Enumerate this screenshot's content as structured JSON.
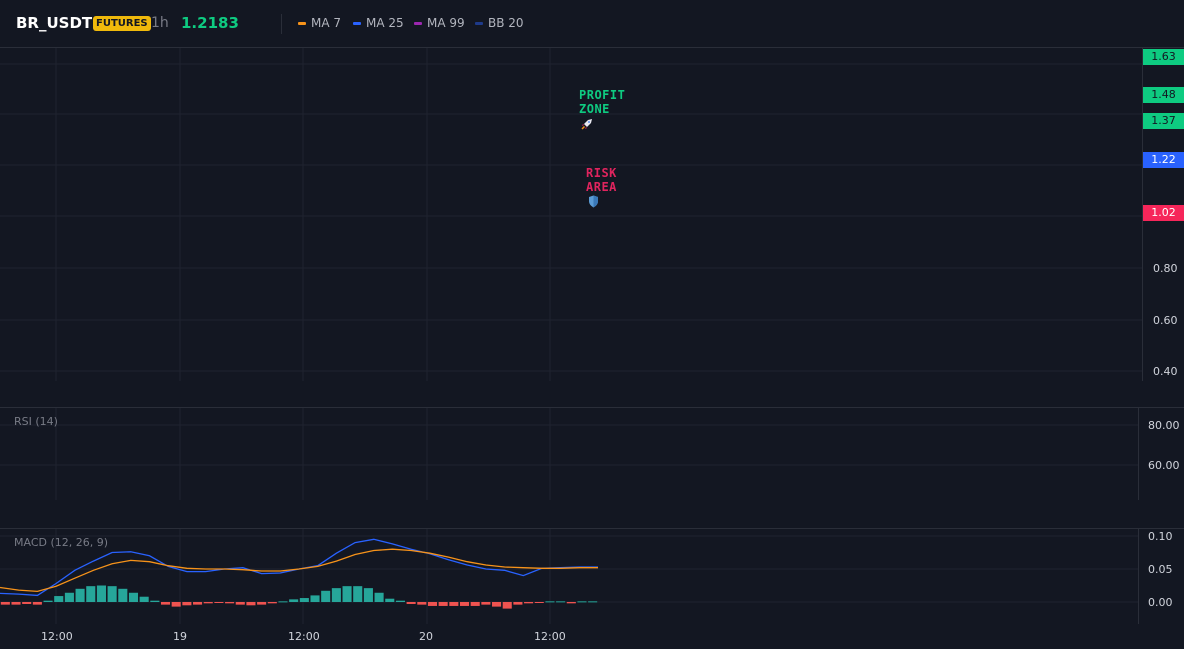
{
  "header": {
    "symbol": "BR_USDT",
    "badge": "FUTURES",
    "timeframe": "1h",
    "last_price": "1.2183",
    "indicators": [
      {
        "label": "MA 7",
        "color": "#f7931a"
      },
      {
        "label": "MA 25",
        "color": "#2962ff"
      },
      {
        "label": "MA 99",
        "color": "#9c27b0"
      },
      {
        "label": "BB 20",
        "color": "#1e3a8a"
      }
    ]
  },
  "price_axis": {
    "labels": [
      "0.80",
      "0.60",
      "0.40"
    ],
    "tags": [
      {
        "label": "1.63",
        "color": "#0ecb81",
        "kind": "green"
      },
      {
        "label": "1.48",
        "color": "#0ecb81",
        "kind": "green"
      },
      {
        "label": "1.37",
        "color": "#0ecb81",
        "kind": "green"
      },
      {
        "label": "1.22",
        "color": "#2962ff",
        "kind": "blue"
      },
      {
        "label": "1.02",
        "color": "#f6265a",
        "kind": "red"
      }
    ]
  },
  "annotations": {
    "profit": {
      "line1": "PROFIT",
      "line2": "ZONE",
      "icon": "rocket-icon",
      "color": "#0ecb81"
    },
    "risk": {
      "line1": "RISK",
      "line2": "AREA",
      "icon": "shield-icon",
      "color": "#e0245e"
    }
  },
  "rsi": {
    "title": "RSI (14)",
    "labels": [
      "80.00",
      "60.00"
    ]
  },
  "macd": {
    "title": "MACD (12, 26, 9)",
    "labels": [
      "0.10",
      "0.05",
      "0.00"
    ]
  },
  "time_axis": {
    "labels": [
      "12:00",
      "19",
      "12:00",
      "20",
      "12:00"
    ]
  },
  "chart_data": {
    "type": "line",
    "title": "MACD (12, 26, 9)",
    "ylim": [
      -0.02,
      0.11
    ],
    "x_steps": 24,
    "series": [
      {
        "name": "",
        "color": "#2962ff",
        "values": [
          0.013,
          0.012,
          0.01,
          0.028,
          0.048,
          0.062,
          0.075,
          0.076,
          0.07,
          0.054,
          0.046,
          0.046,
          0.05,
          0.052,
          0.043,
          0.044,
          0.05,
          0.055,
          0.074,
          0.09,
          0.095,
          0.088,
          0.08,
          0.073,
          0.064,
          0.056,
          0.05,
          0.048,
          0.04,
          0.051,
          0.052,
          0.053,
          0.053
        ]
      },
      {
        "name": "",
        "color": "#f7931a",
        "values": [
          0.022,
          0.018,
          0.016,
          0.024,
          0.036,
          0.048,
          0.058,
          0.063,
          0.061,
          0.055,
          0.051,
          0.05,
          0.05,
          0.049,
          0.047,
          0.047,
          0.05,
          0.054,
          0.062,
          0.072,
          0.078,
          0.08,
          0.078,
          0.074,
          0.068,
          0.061,
          0.056,
          0.053,
          0.052,
          0.051,
          0.051,
          0.052,
          0.052
        ]
      }
    ],
    "histogram": [
      -0.004,
      -0.004,
      -0.003,
      -0.004,
      0.002,
      0.009,
      0.014,
      0.02,
      0.024,
      0.025,
      0.024,
      0.02,
      0.014,
      0.008,
      0.002,
      -0.004,
      -0.007,
      -0.005,
      -0.004,
      -0.002,
      -0.001,
      -0.002,
      -0.004,
      -0.005,
      -0.004,
      -0.002,
      0.001,
      0.004,
      0.006,
      0.01,
      0.017,
      0.021,
      0.024,
      0.024,
      0.021,
      0.014,
      0.005,
      0.002,
      -0.003,
      -0.004,
      -0.006,
      -0.006,
      -0.006,
      -0.006,
      -0.006,
      -0.004,
      -0.007,
      -0.01,
      -0.004,
      -0.002,
      -0.001,
      0.001,
      0.001,
      -0.002,
      0.001,
      0.001
    ]
  }
}
